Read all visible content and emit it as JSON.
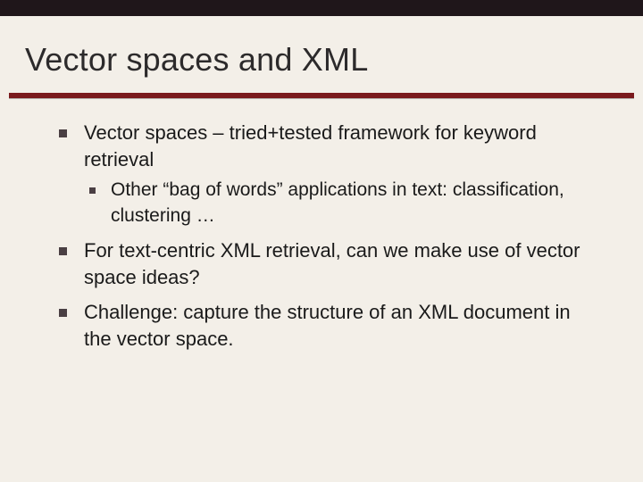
{
  "slide": {
    "title": "Vector spaces and XML",
    "bullets": [
      {
        "text": "Vector spaces – tried+tested framework for keyword retrieval",
        "children": [
          {
            "text": "Other “bag of words” applications in text: classification, clustering …"
          }
        ]
      },
      {
        "text": "For text-centric XML retrieval, can we make use of vector space ideas?"
      },
      {
        "text": "Challenge: capture the structure of an XML document in the vector space."
      }
    ]
  }
}
